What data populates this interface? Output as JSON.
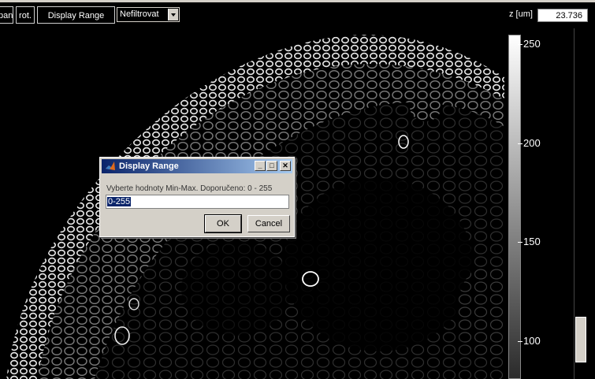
{
  "toolbar": {
    "pan_label": "pan",
    "rot_label": "rot.",
    "display_range_label": "Display Range",
    "filter_value": "Nefiltrovat"
  },
  "z_readout": {
    "label": "z [um]",
    "value": "23.736"
  },
  "colorbar": {
    "ticks": [
      "250",
      "200",
      "150",
      "100"
    ]
  },
  "dialog": {
    "title": "Display Range",
    "prompt": "Vyberte hodnoty Min-Max. Doporučeno: 0 - 255",
    "input_value": "0-255",
    "ok_label": "OK",
    "cancel_label": "Cancel",
    "minimize_glyph": "_",
    "maximize_glyph": "□",
    "close_glyph": "✕"
  },
  "colors": {
    "background": "#000000",
    "dialog_face": "#d4d0c8",
    "title_start": "#0a246a",
    "title_end": "#a6caf0"
  }
}
